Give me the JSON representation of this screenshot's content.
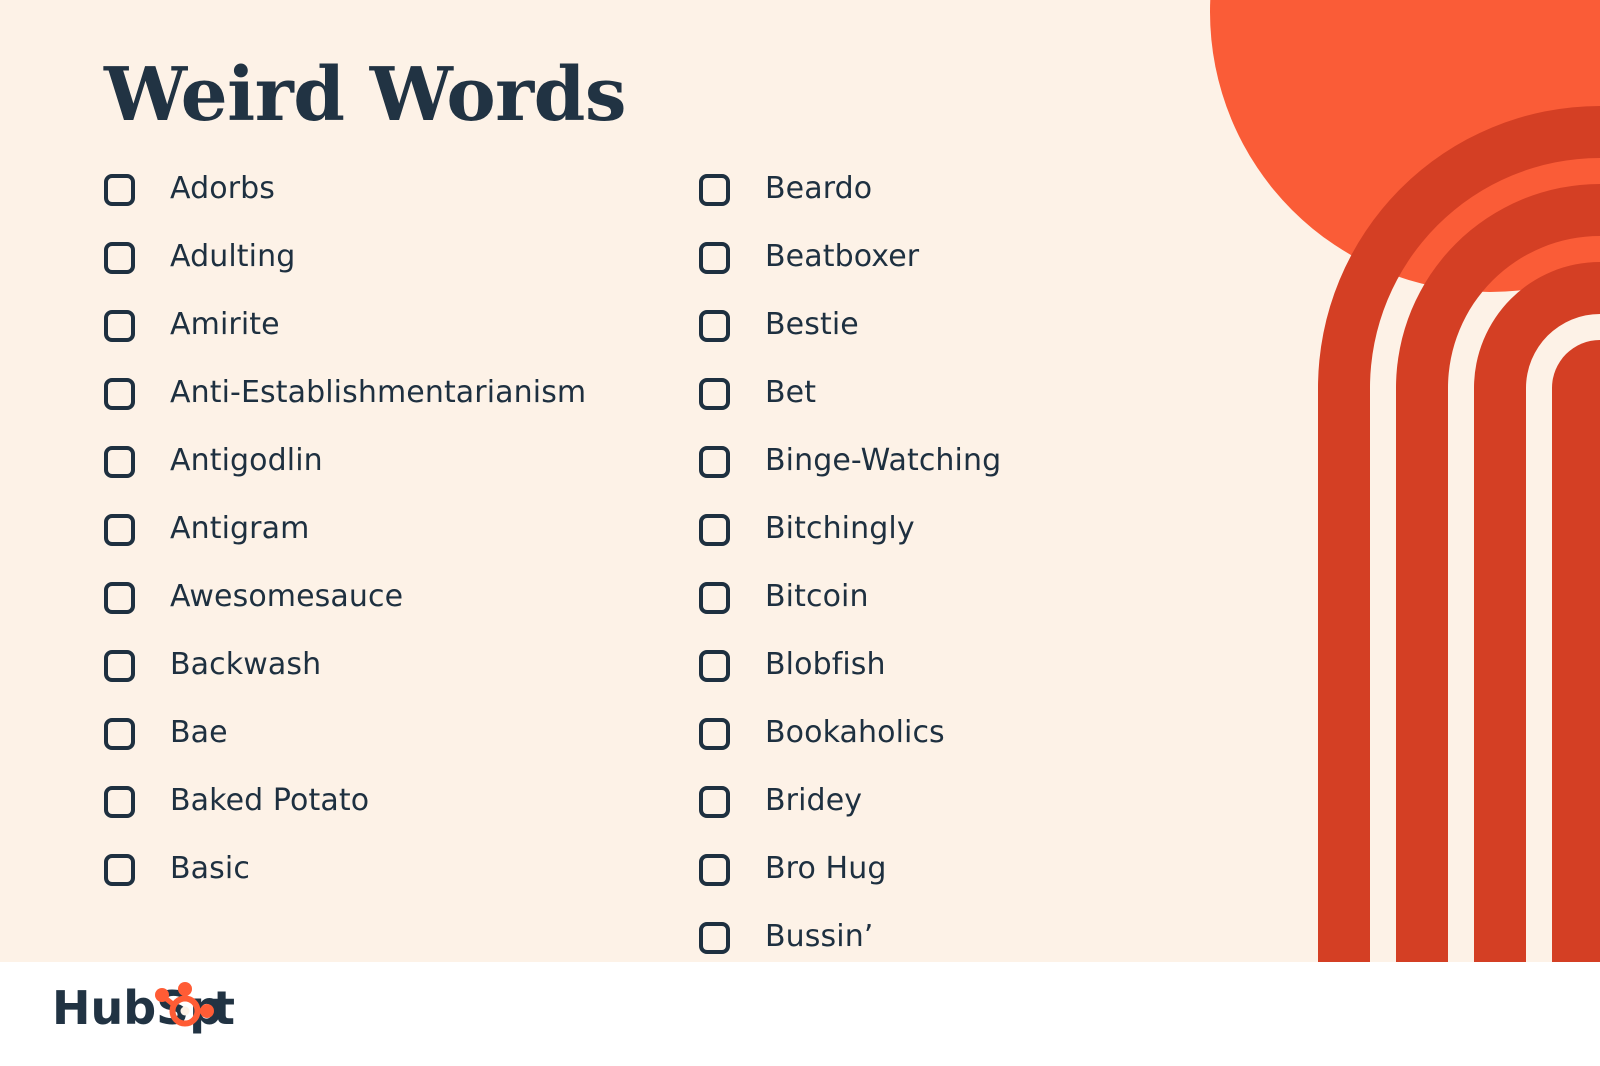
{
  "poster": {
    "title": "Weird Words",
    "background_color": "#FDF2E7",
    "text_color": "#1E3040",
    "accent_orange": "#FA5C37",
    "accent_orange_dark": "#D43F24",
    "footer_background": "#FFFFFF"
  },
  "checklist": {
    "left_column": [
      {
        "label": "Adorbs"
      },
      {
        "label": "Adulting"
      },
      {
        "label": "Amirite"
      },
      {
        "label": "Anti-Establishmentarianism"
      },
      {
        "label": "Antigodlin"
      },
      {
        "label": "Antigram"
      },
      {
        "label": "Awesomesauce"
      },
      {
        "label": "Backwash"
      },
      {
        "label": "Bae"
      },
      {
        "label": "Baked Potato"
      },
      {
        "label": "Basic"
      }
    ],
    "right_column": [
      {
        "label": "Beardo"
      },
      {
        "label": "Beatboxer"
      },
      {
        "label": "Bestie"
      },
      {
        "label": "Bet"
      },
      {
        "label": "Binge-Watching"
      },
      {
        "label": "Bitchingly"
      },
      {
        "label": "Bitcoin"
      },
      {
        "label": "Blobfish"
      },
      {
        "label": "Bookaholics"
      },
      {
        "label": "Bridey"
      },
      {
        "label": "Bro Hug"
      },
      {
        "label": "Bussin’"
      }
    ]
  },
  "footer": {
    "logo_text_before": "HubSp",
    "logo_text_after": "t",
    "logo_name": "HubSpot"
  },
  "decoration": {
    "circle_name": "orange-circle",
    "arches_name": "concentric-arches"
  }
}
